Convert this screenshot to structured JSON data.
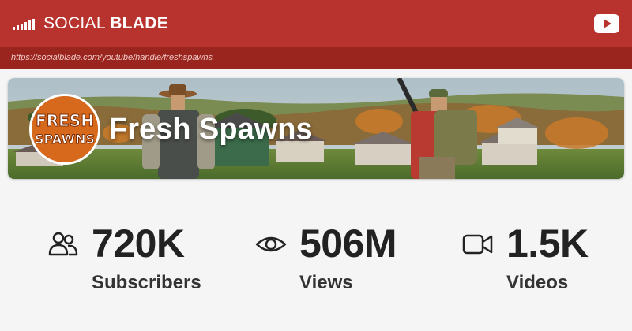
{
  "header": {
    "brand_light": "SOCIAL ",
    "brand_bold": "BLADE",
    "url": "https://socialblade.com/youtube/handle/freshspawns"
  },
  "channel": {
    "name": "Fresh Spawns",
    "avatar_text_top": "FRESH",
    "avatar_text_bottom": "SPAWNS"
  },
  "stats": [
    {
      "value": "720K",
      "label": "Subscribers",
      "icon": "users-icon"
    },
    {
      "value": "506M",
      "label": "Views",
      "icon": "eye-icon"
    },
    {
      "value": "1.5K",
      "label": "Videos",
      "icon": "video-camera-icon"
    }
  ],
  "colors": {
    "header": "#b8332d",
    "url_bar": "#9a251f",
    "avatar": "#d6691c"
  }
}
